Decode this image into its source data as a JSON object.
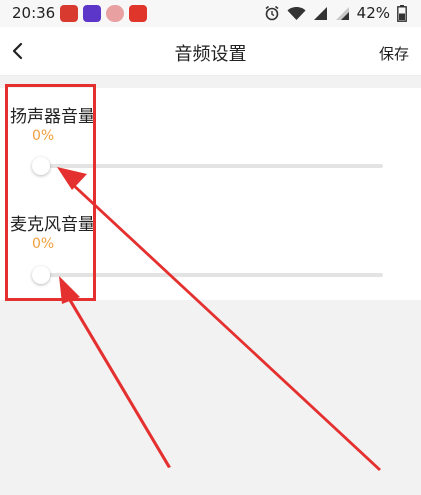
{
  "status_bar": {
    "time": "20:36",
    "battery": "42%",
    "icons": [
      "app-news-icon",
      "app-video-icon",
      "app-avatar-icon",
      "app-news2-icon",
      "alarm-icon",
      "wifi-icon",
      "signal-icon",
      "signal-icon-2",
      "battery-icon"
    ]
  },
  "header": {
    "back_icon": "chevron-left-icon",
    "title": "音频设置",
    "save_label": "保存"
  },
  "settings": {
    "speaker": {
      "label": "扬声器音量",
      "value": "0%",
      "level": 0
    },
    "mic": {
      "label": "麦克风音量",
      "value": "0%",
      "level": 0
    }
  },
  "colors": {
    "accent": "#f0a040",
    "annotation": "#e53030",
    "background": "#f2f2f2"
  }
}
